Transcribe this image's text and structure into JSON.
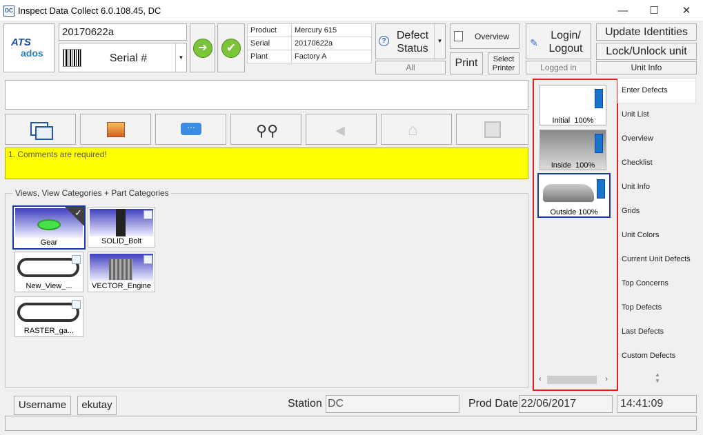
{
  "window": {
    "title": "Inspect Data Collect 6.0.108.45, DC",
    "icon_text": "DC",
    "minimize": "—",
    "maximize": "☐",
    "close": "✕"
  },
  "logo": {
    "top": "ATS",
    "bottom": "ados"
  },
  "unit_id_value": "20170622a",
  "serial_selector": {
    "label": "Serial #"
  },
  "info_table": [
    {
      "key": "Product",
      "value": "Mercury 615"
    },
    {
      "key": "Serial",
      "value": "20170622a"
    },
    {
      "key": "Plant",
      "value": "Factory A"
    }
  ],
  "defect_status": {
    "label_line1": "Defect",
    "label_line2": "Status",
    "filter": "All"
  },
  "overview_button": "Overview",
  "print_button": "Print",
  "select_printer_line1": "Select",
  "select_printer_line2": "Printer",
  "login": {
    "line1": "Login/",
    "line2": "Logout",
    "status": "Logged in"
  },
  "update_identities": "Update Identities",
  "lock_unlock": "Lock/Unlock unit",
  "unit_info_button": "Unit Info",
  "message": "1. Comments are required!",
  "views_group_title": "Views, View Categories + Part Categories",
  "views": [
    {
      "label": "Gear"
    },
    {
      "label": "SOLID_Bolt"
    },
    {
      "label": "New_View_..."
    },
    {
      "label": "VECTOR_Engine"
    },
    {
      "label": "RASTER_ga..."
    }
  ],
  "view_thumbs": [
    {
      "label": "Initial",
      "pct": "100%"
    },
    {
      "label": "Inside",
      "pct": "100%"
    },
    {
      "label": "Outside",
      "pct": "100%"
    }
  ],
  "side_menu": [
    "Enter Defects",
    "Unit List",
    "Overview",
    "Checklist",
    "Unit Info",
    "Grids",
    "Unit Colors",
    "Current Unit Defects",
    "Top Concerns",
    "Top Defects",
    "Last Defects",
    "Custom Defects"
  ],
  "status_bar": {
    "username_label": "Username",
    "username_value": "ekutay",
    "station_label": "Station",
    "station_value": "DC",
    "prod_date_label": "Prod Date",
    "prod_date_value": "22/06/2017",
    "time_value": "14:41:09"
  },
  "colors": {
    "highlight_red": "#e02020",
    "selected_blue": "#1a3aa8",
    "message_yellow": "#ffff00",
    "gauge_blue": "#1874cd"
  }
}
